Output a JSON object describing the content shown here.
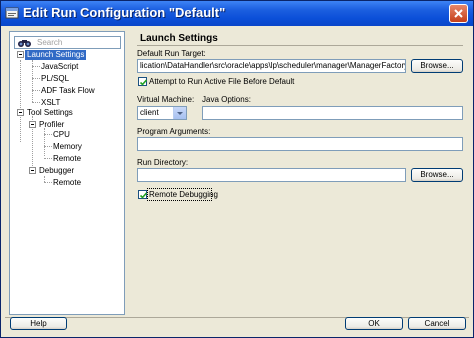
{
  "window": {
    "title": "Edit Run Configuration \"Default\""
  },
  "search": {
    "placeholder": "Search"
  },
  "tree": {
    "launch_settings": "Launch Settings",
    "javascript": "JavaScript",
    "plsql": "PL/SQL",
    "adf_task_flow": "ADF Task Flow",
    "xslt": "XSLT",
    "tool_settings": "Tool Settings",
    "profiler": "Profiler",
    "cpu": "CPU",
    "memory": "Memory",
    "remote_profiler": "Remote",
    "debugger": "Debugger",
    "remote_debugger": "Remote"
  },
  "panel": {
    "title": "Launch Settings",
    "default_run_target_label": "Default Run Target:",
    "default_run_target_value": "lication\\DataHandler\\src\\oracle\\apps\\lp\\scheduler\\manager\\ManagerFactory.java",
    "browse_label": "Browse...",
    "attempt_run_active_label": "Attempt to Run Active File Before Default",
    "attempt_run_active_checked": true,
    "virtual_machine_label": "Virtual Machine:",
    "virtual_machine_value": "client",
    "java_options_label": "Java Options:",
    "java_options_value": "",
    "program_arguments_label": "Program Arguments:",
    "program_arguments_value": "",
    "run_directory_label": "Run Directory:",
    "run_directory_value": "",
    "browse2_label": "Browse...",
    "remote_debugging_label": "Remote Debugging",
    "remote_debugging_checked": true
  },
  "footer": {
    "help": "Help",
    "ok": "OK",
    "cancel": "Cancel"
  }
}
